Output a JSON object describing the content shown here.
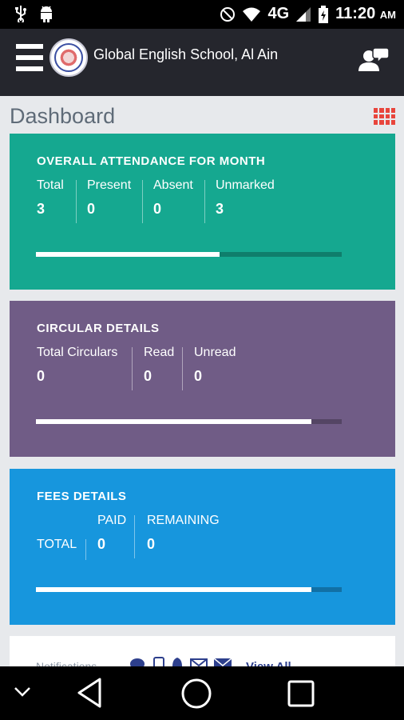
{
  "status_bar": {
    "network": "4G",
    "time": "11:20",
    "ampm": "AM"
  },
  "app_bar": {
    "title": "Global English School, Al Ain"
  },
  "page": {
    "title": "Dashboard"
  },
  "attendance": {
    "title": "OVERALL ATTENDANCE FOR  MONTH",
    "stats": [
      {
        "label": "Total",
        "value": "3"
      },
      {
        "label": "Present",
        "value": "0"
      },
      {
        "label": "Absent",
        "value": "0"
      },
      {
        "label": "Unmarked",
        "value": "3"
      }
    ],
    "progress_fraction": 0.6,
    "color": "#15a890"
  },
  "circular": {
    "title": "CIRCULAR DETAILS",
    "stats": [
      {
        "label": "Total Circulars",
        "value": "0"
      },
      {
        "label": "Read",
        "value": "0"
      },
      {
        "label": "Unread",
        "value": "0"
      }
    ],
    "progress_fraction": 0.9,
    "color": "#705c86"
  },
  "fees": {
    "title": "FEES  DETAILS",
    "row_label": "TOTAL",
    "stats": [
      {
        "label": "PAID",
        "value": "0"
      },
      {
        "label": "REMAINING",
        "value": "0"
      }
    ],
    "progress_fraction": 0.9,
    "color": "#1796dd"
  },
  "notifications": {
    "label": "Notifications",
    "view_all": "View All"
  },
  "icons": {
    "usb": "usb-icon",
    "android": "android-icon",
    "dnd": "do-not-disturb-icon",
    "wifi": "wifi-icon",
    "signal": "signal-icon",
    "battery": "battery-icon",
    "menu": "hamburger-menu-icon",
    "profile": "user-chat-icon",
    "grid": "grid-view-icon",
    "back": "back-icon",
    "home": "home-icon",
    "recents": "recents-icon",
    "collapse": "chevron-down-icon"
  }
}
